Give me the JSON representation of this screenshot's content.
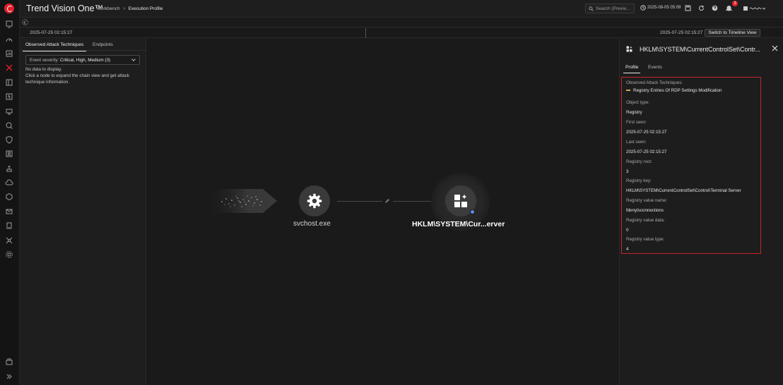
{
  "app": {
    "title": "Trend Vision One™"
  },
  "breadcrumb": {
    "parent": "Workbench",
    "separator": ">",
    "current": "Execution Profile"
  },
  "search": {
    "placeholder": "Search (Previe..."
  },
  "clock": {
    "time": "2025-08-05 05:09"
  },
  "notifications": {
    "count": "3"
  },
  "timeline": {
    "start": "2025-07-25 02:15:27",
    "end": "2025-07-25 02:15:27",
    "switch_label": "Switch to Timeline View"
  },
  "left_panel": {
    "tabs": [
      "Observed Attack Techniques",
      "Endpoints"
    ],
    "severity_label": "Event severity:",
    "severity_value": "Critical, High, Medium (3)",
    "no_data": "No data to display.",
    "hint": "Click a node to expand the chain view and get attack technique information."
  },
  "graph": {
    "node_process_label": "svchost.exe",
    "node_registry_label": "HKLM\\SYSTEM\\Cur...erver"
  },
  "right_panel": {
    "title": "HKLM\\SYSTEM\\CurrentControlSet\\Contr...",
    "tabs": [
      "Profile",
      "Events"
    ],
    "props": {
      "techniques_label": "Observed Attack Techniques:",
      "technique": "Registry Entries Of RDP Settings Modification",
      "object_type_label": "Object type:",
      "object_type": "Registry",
      "first_seen_label": "First seen:",
      "first_seen": "2025-07-25 02:15:27",
      "last_seen_label": "Last seen:",
      "last_seen": "2025-07-25 02:15:27",
      "registry_root_label": "Registry root:",
      "registry_root": "3",
      "registry_key_label": "Registry key:",
      "registry_key": "HKLM\\SYSTEM\\CurrentControlSet\\Control\\Terminal Server",
      "value_name_label": "Registry value name:",
      "value_name": "fdenytsconnections",
      "value_data_label": "Registry value data:",
      "value_data": "0",
      "value_type_label": "Registry value type:",
      "value_type": "4"
    }
  },
  "colors": {
    "accent_red": "#e3202a",
    "highlight_border": "#c6252c",
    "node_dot": "#5b8de8"
  }
}
